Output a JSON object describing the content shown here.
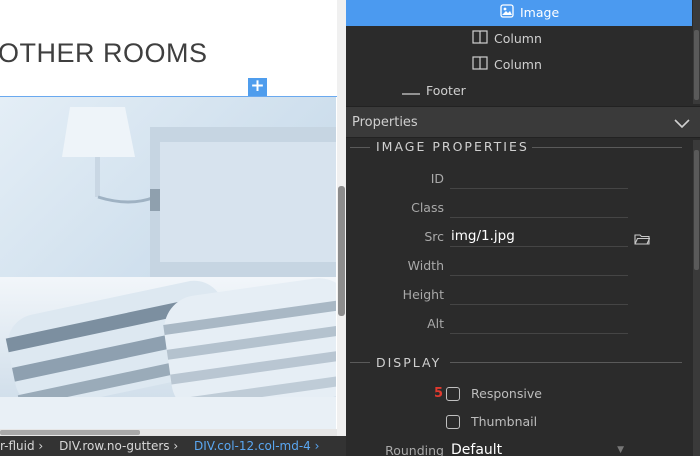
{
  "canvas": {
    "heading": "OTHER ROOMS",
    "add_button_glyph": "+"
  },
  "breadcrumb": [
    "r-fluid ›",
    "DIV.row.no-gutters ›",
    "DIV.col-12.col-md-4 ›"
  ],
  "tree": {
    "items": [
      {
        "label": "Image",
        "icon": "image-icon",
        "selected": true
      },
      {
        "label": "Column",
        "icon": "column-icon"
      },
      {
        "label": "Column",
        "icon": "column-icon"
      },
      {
        "label": "Footer",
        "icon": "footer-icon"
      }
    ]
  },
  "properties": {
    "header": "Properties",
    "image_section": "IMAGE PROPERTIES",
    "fields": [
      {
        "label": "ID",
        "value": ""
      },
      {
        "label": "Class",
        "value": ""
      },
      {
        "label": "Src",
        "value": "img/1.jpg"
      },
      {
        "label": "Width",
        "value": ""
      },
      {
        "label": "Height",
        "value": ""
      },
      {
        "label": "Alt",
        "value": ""
      }
    ],
    "display_section": "DISPLAY",
    "checkbox_marker": "5",
    "checkboxes": [
      {
        "label": "Responsive",
        "checked": false
      },
      {
        "label": "Thumbnail",
        "checked": false
      }
    ],
    "rounding": {
      "label": "Rounding",
      "value": "Default"
    }
  },
  "colors": {
    "accent": "#4b9af0",
    "marker": "#e03a2f"
  }
}
